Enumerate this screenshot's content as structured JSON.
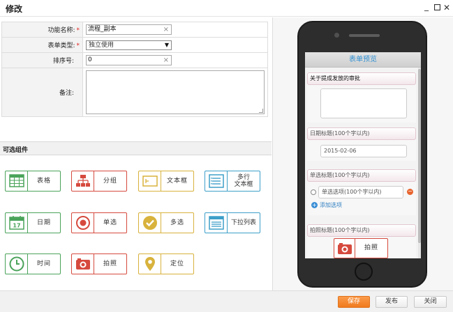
{
  "window": {
    "title": "修改"
  },
  "form": {
    "name_label": "功能名称:",
    "name_value": "流程_副本",
    "type_label": "表单类型:",
    "type_value": "独立使用",
    "order_label": "排序号:",
    "order_value": "0",
    "note_label": "备注:",
    "note_value": "",
    "required_mark": "*",
    "clear_glyph": "×",
    "dropdown_glyph": "▼"
  },
  "components": {
    "section_title": "可选组件",
    "items": [
      {
        "label": "表格",
        "icon": "table-icon"
      },
      {
        "label": "分组",
        "icon": "group-icon"
      },
      {
        "label": "文本框",
        "icon": "textbox-icon"
      },
      {
        "label": "多行\n文本框",
        "icon": "multiline-icon"
      },
      {
        "label": "日期",
        "icon": "calendar-icon"
      },
      {
        "label": "单选",
        "icon": "radio-icon"
      },
      {
        "label": "多选",
        "icon": "checkbox-icon"
      },
      {
        "label": "下拉列表",
        "icon": "dropdown-list-icon"
      },
      {
        "label": "时间",
        "icon": "clock-icon"
      },
      {
        "label": "拍照",
        "icon": "camera-icon"
      },
      {
        "label": "定位",
        "icon": "location-pin-icon"
      }
    ],
    "calendar_day": "17"
  },
  "preview": {
    "title": "表单预览",
    "approval_heading": "关于提成发放的审批",
    "date_heading": "日期标题(100个字以内)",
    "date_value": "2015-02-06",
    "radio_heading": "单选标题(100个字以内)",
    "radio_option": "单选选项(100个字以内)",
    "minus_glyph": "−",
    "plus_glyph": "+",
    "add_option": "添加选项",
    "photo_heading": "拍照标题(100个字以内)",
    "photo_button": "拍照"
  },
  "footer": {
    "save": "保存",
    "publish": "发布",
    "close": "关闭"
  },
  "colors": {
    "green": "#4aa35a",
    "red": "#d64a3e",
    "yellow": "#d8b23c",
    "blue": "#3d9fc9",
    "primary_button": "#f07a1e",
    "preview_title": "#2f8fd1"
  }
}
